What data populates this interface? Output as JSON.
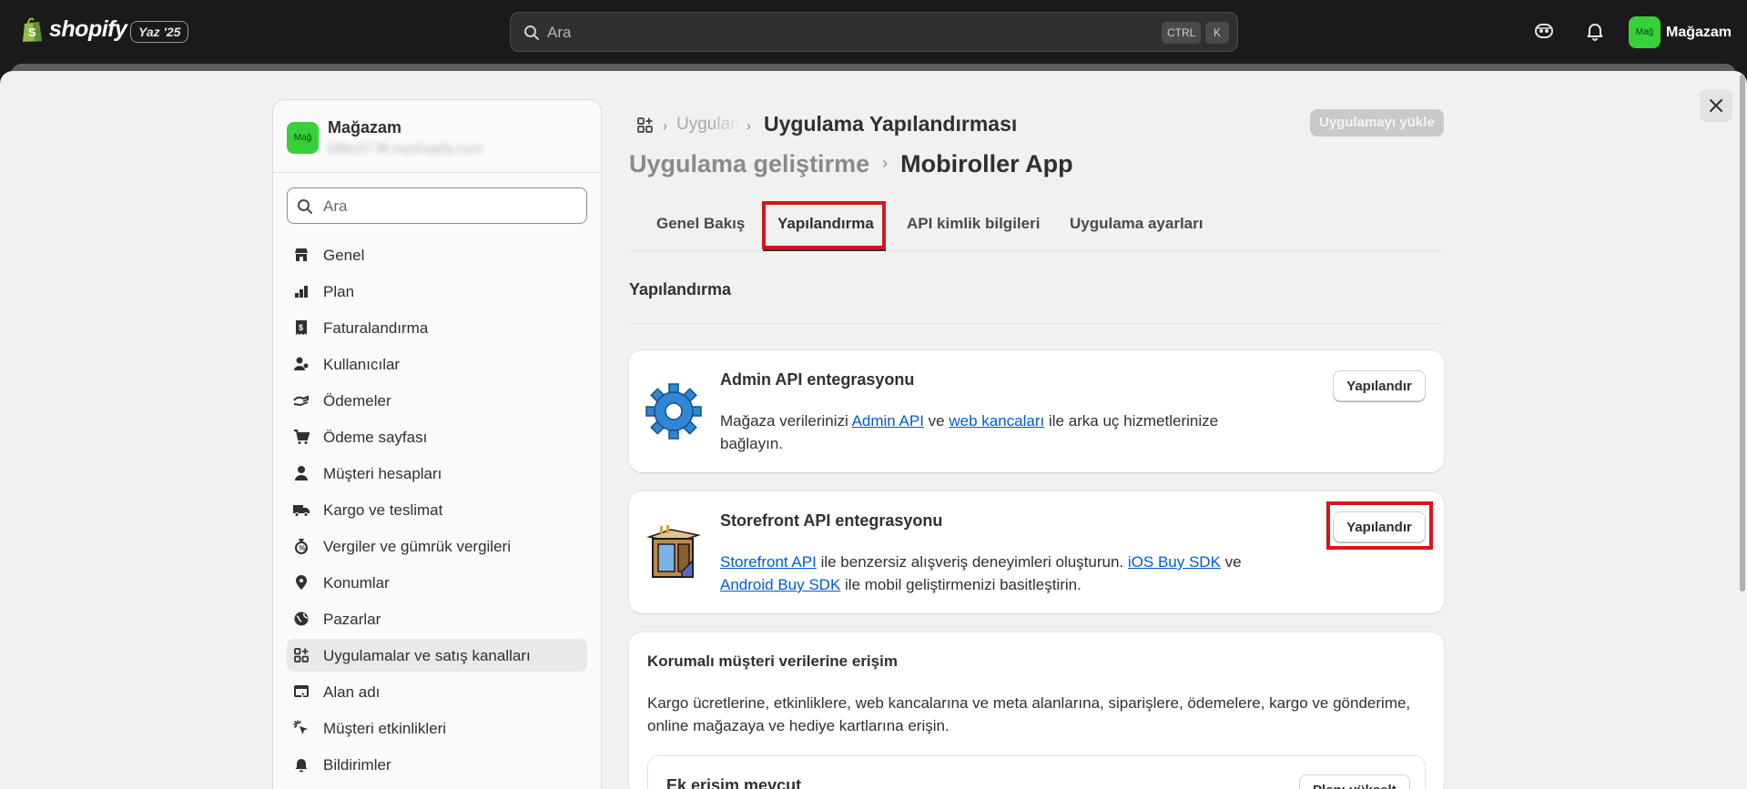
{
  "topbar": {
    "brand": "shopify",
    "edition": "Yaz '25",
    "search_placeholder": "Ara",
    "shortcut_ctrl": "CTRL",
    "shortcut_k": "K",
    "avatar_initials": "Mağ",
    "store_name": "Mağazam"
  },
  "sidebar": {
    "avatar_initials": "Mağ",
    "store_name": "Mağazam",
    "email": "b8bc07-f8.myshopify.com",
    "search_placeholder": "Ara",
    "items": [
      {
        "label": "Genel",
        "icon": "store-icon"
      },
      {
        "label": "Plan",
        "icon": "plan-icon"
      },
      {
        "label": "Faturalandırma",
        "icon": "receipt-icon"
      },
      {
        "label": "Kullanıcılar",
        "icon": "users-icon"
      },
      {
        "label": "Ödemeler",
        "icon": "payments-icon"
      },
      {
        "label": "Ödeme sayfası",
        "icon": "cart-icon"
      },
      {
        "label": "Müşteri hesapları",
        "icon": "person-icon"
      },
      {
        "label": "Kargo ve teslimat",
        "icon": "truck-icon"
      },
      {
        "label": "Vergiler ve gümrük vergileri",
        "icon": "tax-icon"
      },
      {
        "label": "Konumlar",
        "icon": "location-icon"
      },
      {
        "label": "Pazarlar",
        "icon": "globe-icon"
      },
      {
        "label": "Uygulamalar ve satış kanalları",
        "icon": "apps-icon"
      },
      {
        "label": "Alan adı",
        "icon": "domain-icon"
      },
      {
        "label": "Müşteri etkinlikleri",
        "icon": "cursor-icon"
      },
      {
        "label": "Bildirimler",
        "icon": "bell-icon"
      }
    ],
    "active_index": 11
  },
  "main": {
    "breadcrumb_faded": "Uygulamalar",
    "breadcrumb_title": "Uygulama Yapılandırması",
    "install_button": "Uygulamayı yükle",
    "heading_parent": "Uygulama geliştirme",
    "heading_title": "Mobiroller App",
    "tabs": [
      {
        "label": "Genel Bakış"
      },
      {
        "label": "Yapılandırma"
      },
      {
        "label": "API kimlik bilgileri"
      },
      {
        "label": "Uygulama ayarları"
      }
    ],
    "active_tab": 1,
    "section_title": "Yapılandırma",
    "cards": {
      "admin": {
        "title": "Admin API entegrasyonu",
        "text_1": "Mağaza verilerinizi ",
        "link_1": "Admin API",
        "text_2": " ve ",
        "link_2": "web kancaları",
        "text_3": " ile arka uç hizmetlerinize bağlayın.",
        "button": "Yapılandır"
      },
      "storefront": {
        "title": "Storefront API entegrasyonu",
        "link_1": "Storefront API",
        "text_1": " ile benzersiz alışveriş deneyimleri oluşturun. ",
        "link_2": "iOS Buy SDK",
        "text_2": " ve ",
        "link_3": "Android Buy SDK",
        "text_3": " ile mobil geliştirmenizi basitleştirin.",
        "button": "Yapılandır"
      },
      "protected": {
        "title": "Korumalı müşteri verilerine erişim",
        "body": "Kargo ücretlerine, etkinliklere, web kancalarına ve meta alanlarına, siparişlere, ödemelere, kargo ve gönderime, online mağazaya ve hediye kartlarına erişin.",
        "sub_title": "Ek erişim mevcut",
        "sub_button": "Planı yükselt"
      }
    }
  },
  "colors": {
    "topbar_bg": "#1a1a1a",
    "sheet_bg": "#f1f1f1",
    "highlight": "#d8141b",
    "link": "#005bd3",
    "avatar": "#36d03a"
  }
}
